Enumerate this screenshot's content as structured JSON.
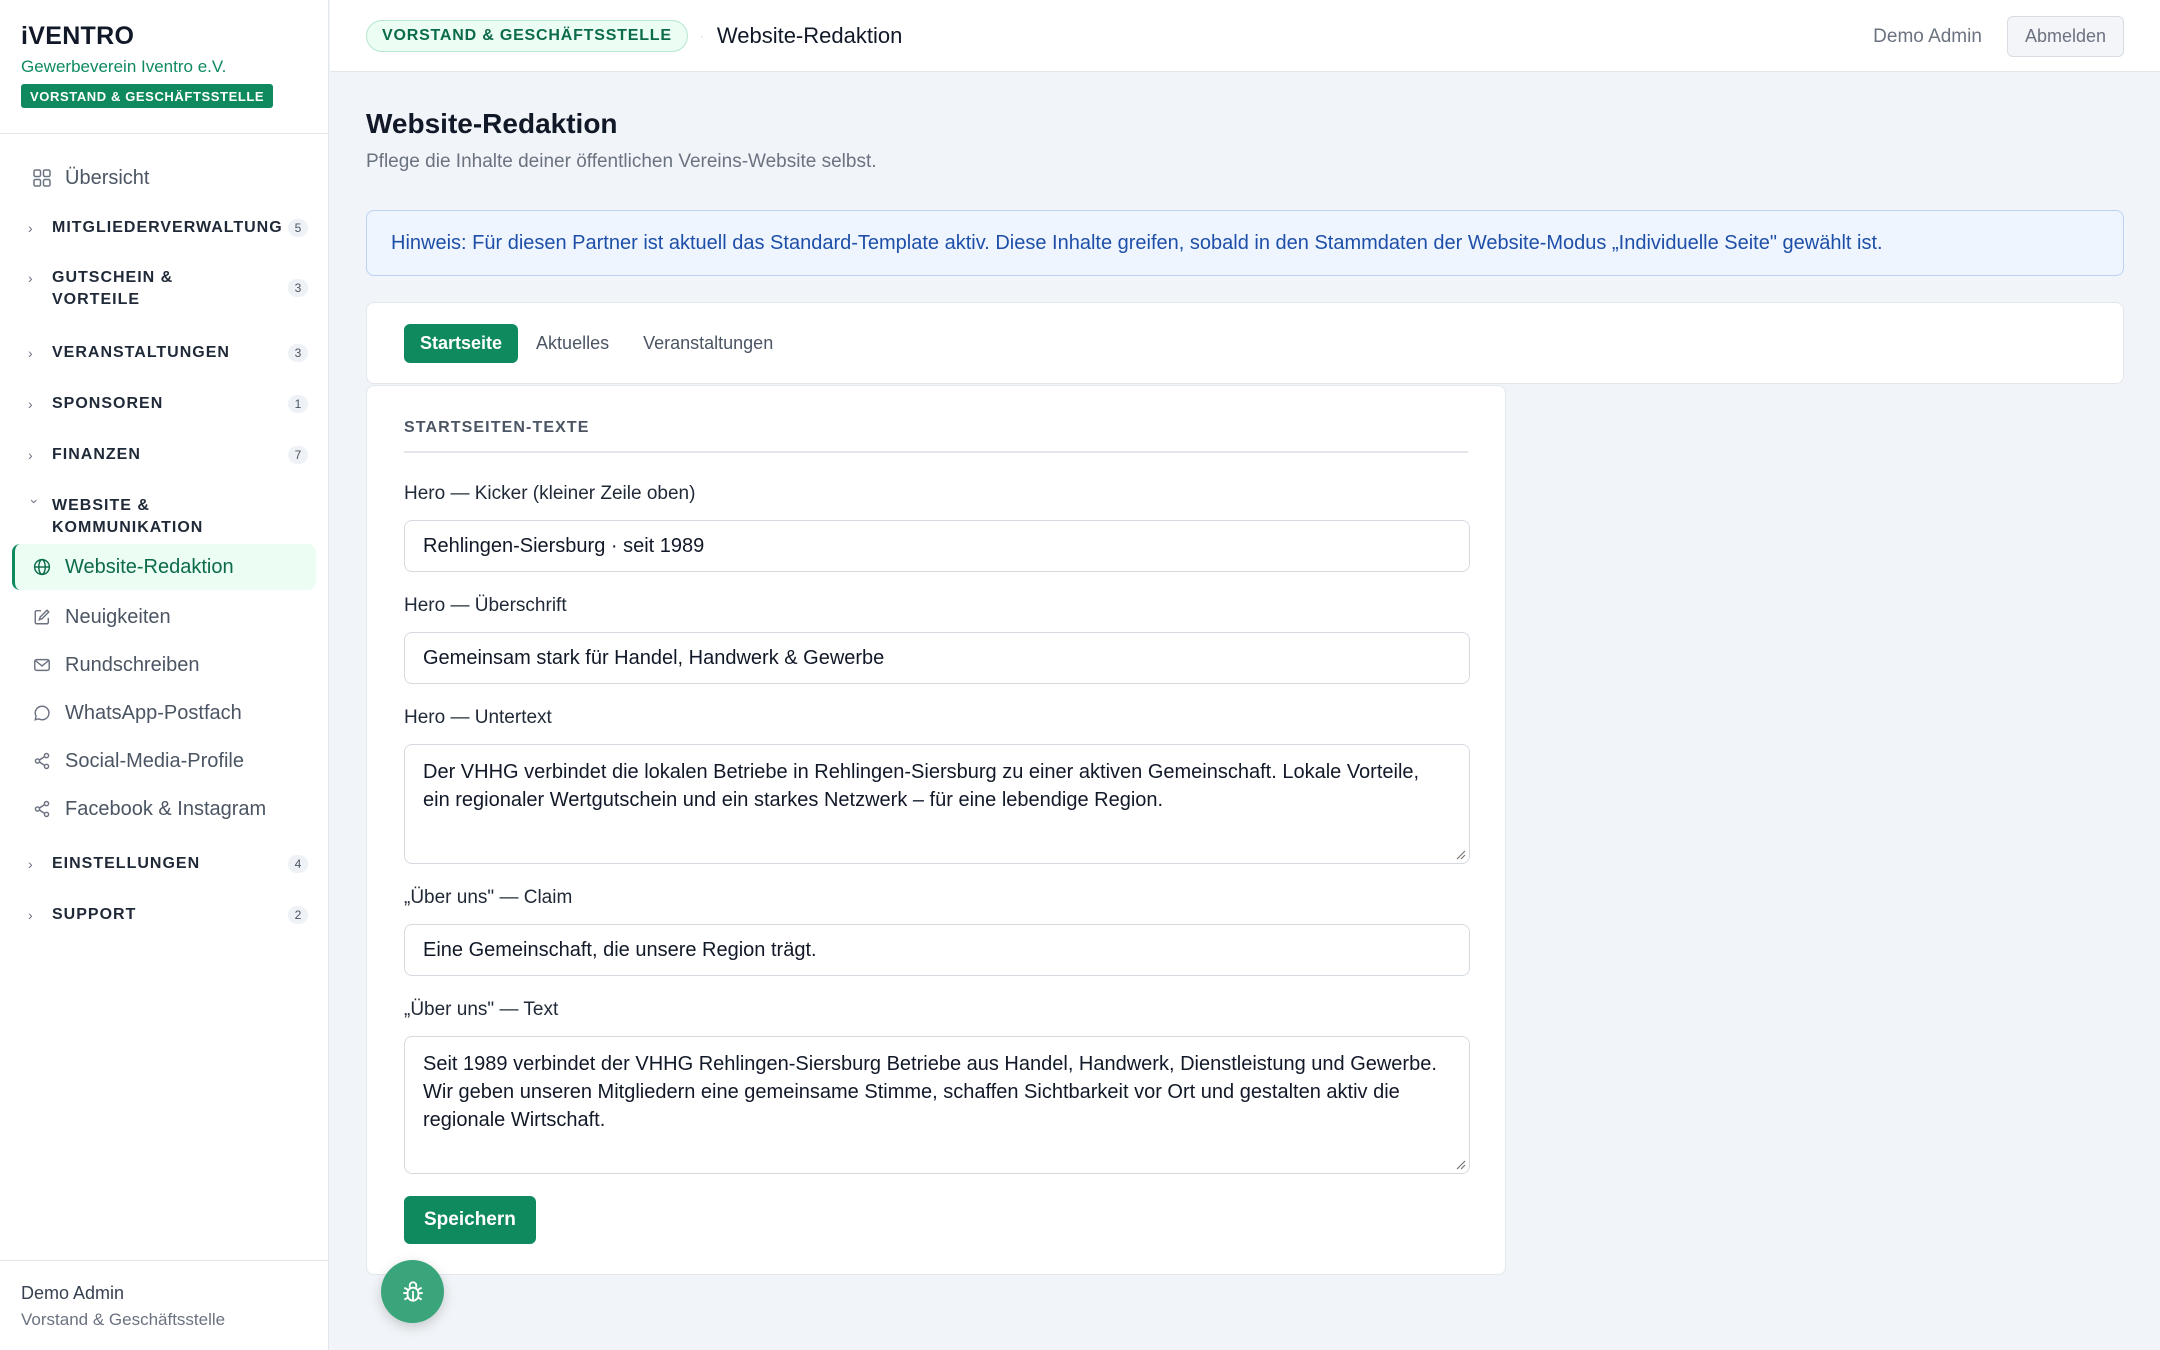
{
  "brand": {
    "logo": "iVENTRO",
    "org": "Gewerbeverein Iventro e.V.",
    "role_badge": "VORSTAND & GESCHÄFTSSTELLE"
  },
  "nav": {
    "overview": "Übersicht",
    "sections": [
      {
        "label": "MITGLIEDERVERWALTUNG",
        "count": "5"
      },
      {
        "label": "GUTSCHEIN & VORTEILE",
        "count": "3"
      },
      {
        "label": "VERANSTALTUNGEN",
        "count": "3"
      },
      {
        "label": "SPONSOREN",
        "count": "1"
      },
      {
        "label": "FINANZEN",
        "count": "7"
      },
      {
        "label": "WEBSITE & KOMMUNIKATION"
      },
      {
        "label": "EINSTELLUNGEN",
        "count": "4"
      },
      {
        "label": "SUPPORT",
        "count": "2"
      }
    ],
    "sub_items": [
      {
        "label": "Website-Redaktion",
        "icon": "globe-icon",
        "active": true
      },
      {
        "label": "Neuigkeiten",
        "icon": "edit-icon"
      },
      {
        "label": "Rundschreiben",
        "icon": "mail-icon"
      },
      {
        "label": "WhatsApp-Postfach",
        "icon": "chat-bubble-icon"
      },
      {
        "label": "Social-Media-Profile",
        "icon": "share-icon"
      },
      {
        "label": "Facebook & Instagram",
        "icon": "share-icon"
      }
    ]
  },
  "sidebar_footer": {
    "name": "Demo Admin",
    "role": "Vorstand & Geschäftsstelle"
  },
  "topbar": {
    "badge": "VORSTAND & GESCHÄFTSSTELLE",
    "title": "Website-Redaktion",
    "user": "Demo Admin",
    "logout": "Abmelden"
  },
  "page": {
    "title": "Website-Redaktion",
    "subtitle": "Pflege die Inhalte deiner öffentlichen Vereins-Website selbst.",
    "hint": "Hinweis: Für diesen Partner ist aktuell das Standard-Template aktiv. Diese Inhalte greifen, sobald in den Stammdaten der Website-Modus „Individuelle Seite\" gewählt ist."
  },
  "tabs": [
    "Startseite",
    "Aktuelles",
    "Veranstaltungen"
  ],
  "form": {
    "section_title": "STARTSEITEN-TEXTE",
    "fields": [
      {
        "label": "Hero — Kicker (kleiner Zeile oben)",
        "value": "Rehlingen-Siersburg · seit 1989"
      },
      {
        "label": "Hero — Überschrift",
        "value": "Gemeinsam stark für Handel, Handwerk & Gewerbe"
      },
      {
        "label": "Hero — Untertext",
        "value": "Der VHHG verbindet die lokalen Betriebe in Rehlingen-Siersburg zu einer aktiven Gemeinschaft. Lokale Vorteile, ein regionaler Wertgutschein und ein starkes Netzwerk – für eine lebendige Region."
      },
      {
        "label": "„Über uns\" — Claim",
        "value": "Eine Gemeinschaft, die unsere Region trägt."
      },
      {
        "label": "„Über uns\" — Text",
        "value": "Seit 1989 verbindet der VHHG Rehlingen-Siersburg Betriebe aus Handel, Handwerk, Dienstleistung und Gewerbe. Wir geben unseren Mitgliedern eine gemeinsame Stimme, schaffen Sichtbarkeit vor Ort und gestalten aktiv die regionale Wirtschaft."
      }
    ],
    "save_label": "Speichern"
  },
  "colors": {
    "brand_green": "#0f8a5f",
    "hint_blue": "#1e4fa8",
    "background": "#f1f4f8"
  }
}
